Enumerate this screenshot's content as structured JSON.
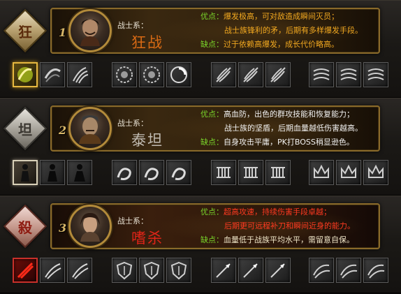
{
  "classes": [
    {
      "glyph": "狂",
      "rank": "1",
      "class_label": "战士系：",
      "class_name": "狂战",
      "pros_key": "优点：",
      "pros_lines": [
        "爆发极高，可对敌造成瞬间灭员；",
        "战士族锋利的矛，后期有多样爆发手段。"
      ],
      "cons_key": "缺点：",
      "cons_line": "过于依赖高爆发，成长代价略高。",
      "portrait_icon": "warrior-portrait-icon",
      "skills": [
        "flame-slash-icon",
        "whirl-slash-icon",
        "claw-icon",
        "gear-seal-icon",
        "gear-seal-icon",
        "spin-seal-icon",
        "feather-blade-icon",
        "feather-blade-icon",
        "feather-blade-icon",
        "wind-roll-icon",
        "wind-roll-icon",
        "wind-roll-icon"
      ],
      "accent": "#f1a820"
    },
    {
      "glyph": "坦",
      "rank": "2",
      "class_label": "战士系：",
      "class_name": "泰坦",
      "pros_key": "优点：",
      "pros_lines": [
        "高血防，出色的群攻技能和恢复能力；",
        "战士族的坚盾，后期血量越低伤害越高。"
      ],
      "cons_key": "缺点：",
      "cons_line": "自身攻击平庸，PK打BOSS稍显逊色。",
      "portrait_icon": "titan-portrait-icon",
      "skills": [
        "figure-icon",
        "figure-icon",
        "figure-icon",
        "dragon-icon",
        "dragon-icon",
        "dragon-icon",
        "pillar-icon",
        "pillar-icon",
        "pillar-icon",
        "crown-icon",
        "crown-icon",
        "crown-icon"
      ],
      "accent": "#c2bdb4"
    },
    {
      "glyph": "殺",
      "rank": "3",
      "class_label": "战士系：",
      "class_name": "嗜杀",
      "pros_key": "优点：",
      "pros_lines": [
        "超高攻速，持续伤害手段卓越；",
        "后期更可远程补刀和瞬间近身的能力。"
      ],
      "cons_key": "缺点：",
      "cons_line": "血量低于战族平均水平，需留意自保。",
      "portrait_icon": "assassin-portrait-icon",
      "skills": [
        "blood-slash-icon",
        "blade-storm-icon",
        "blade-storm-icon",
        "shield-icon",
        "shield-icon",
        "shield-icon",
        "spear-icon",
        "spear-icon",
        "spear-icon",
        "wind-blade-icon",
        "wind-blade-icon",
        "wind-blade-icon"
      ],
      "accent": "#e02418"
    }
  ]
}
